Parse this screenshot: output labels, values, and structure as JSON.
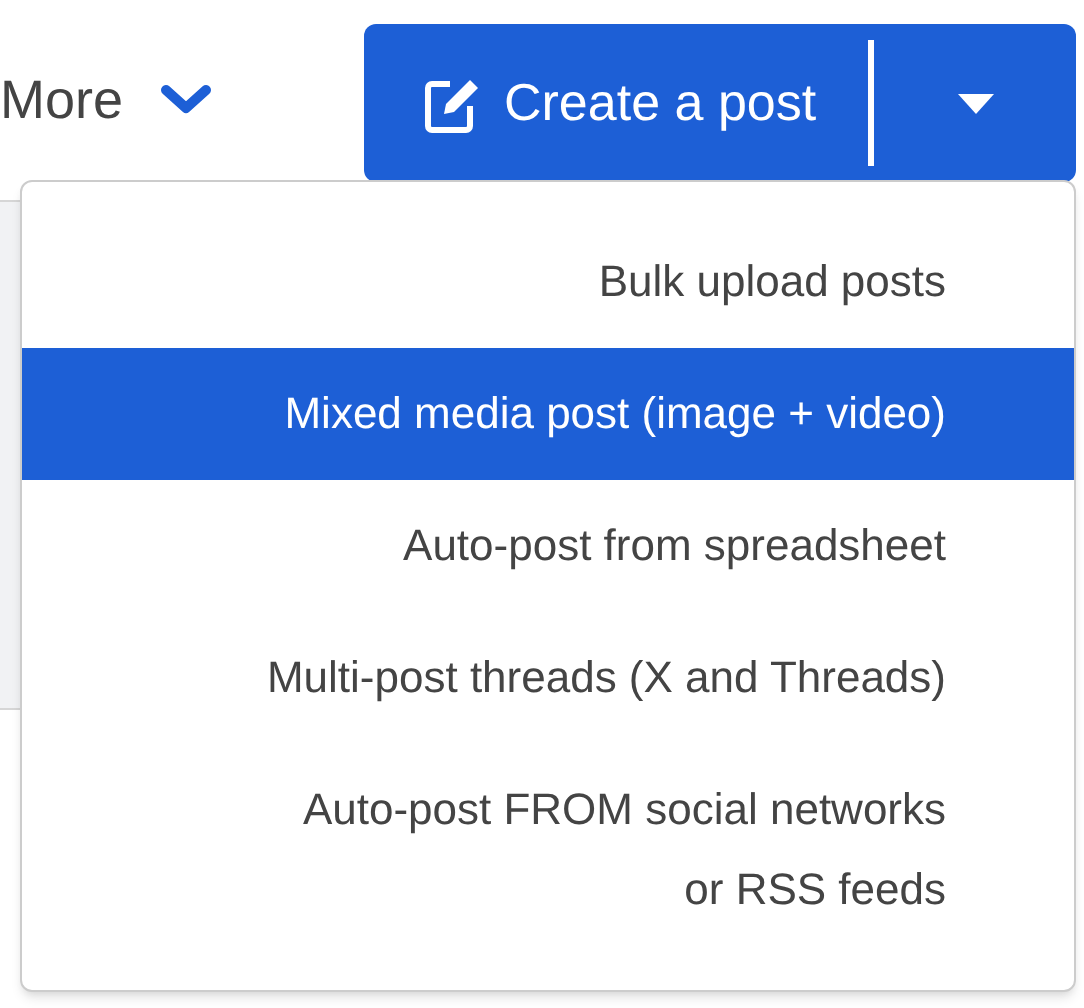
{
  "more_menu": {
    "label": "More"
  },
  "create_button": {
    "label": "Create a post"
  },
  "dropdown": {
    "items": [
      {
        "lines": [
          "Bulk upload posts"
        ],
        "selected": false
      },
      {
        "lines": [
          "Mixed media post (image + video)"
        ],
        "selected": true
      },
      {
        "lines": [
          "Auto-post from spreadsheet"
        ],
        "selected": false
      },
      {
        "lines": [
          "Multi-post threads (X and Threads)"
        ],
        "selected": false
      },
      {
        "lines": [
          "Auto-post FROM social networks",
          "or RSS feeds"
        ],
        "selected": false
      }
    ]
  }
}
